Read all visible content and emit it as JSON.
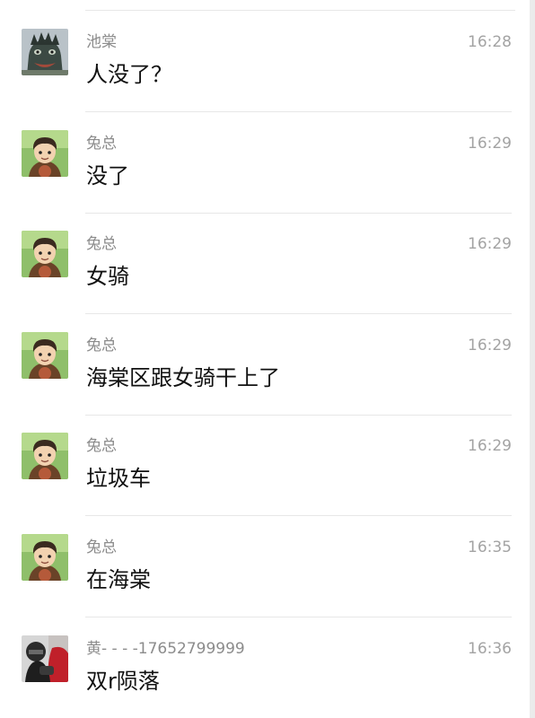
{
  "messages": [
    {
      "sender": "池棠",
      "time": "16:28",
      "text": "人没了？",
      "avatar": "monster-avatar-icon"
    },
    {
      "sender": "兔总",
      "time": "16:29",
      "text": "没了",
      "avatar": "cartoon-boy-avatar-icon"
    },
    {
      "sender": "兔总",
      "time": "16:29",
      "text": "女骑",
      "avatar": "cartoon-boy-avatar-icon"
    },
    {
      "sender": "兔总",
      "time": "16:29",
      "text": "海棠区跟女骑干上了",
      "avatar": "cartoon-boy-avatar-icon"
    },
    {
      "sender": "兔总",
      "time": "16:29",
      "text": "垃圾车",
      "avatar": "cartoon-boy-avatar-icon"
    },
    {
      "sender": "兔总",
      "time": "16:35",
      "text": "在海棠",
      "avatar": "cartoon-boy-avatar-icon"
    },
    {
      "sender": "黄- - - -17652799999",
      "time": "16:36",
      "text": "双r陨落",
      "avatar": "motorcycle-rider-avatar-icon"
    }
  ]
}
